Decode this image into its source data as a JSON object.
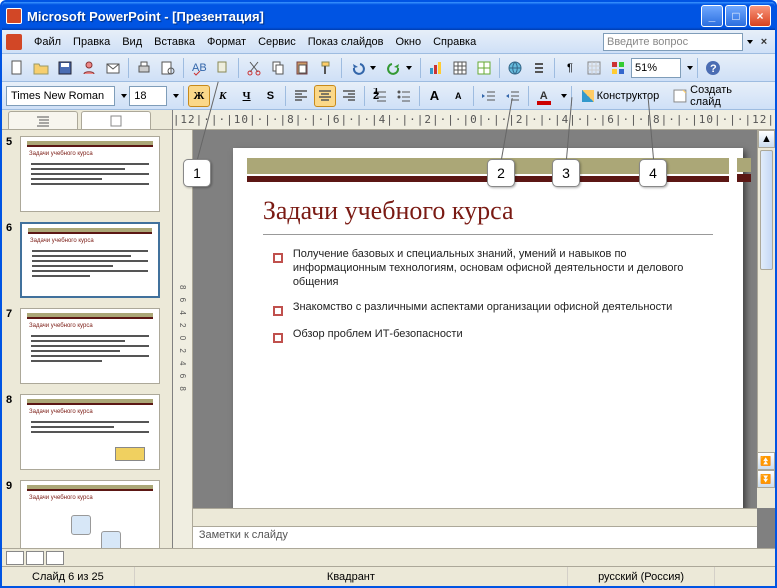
{
  "title": "Microsoft PowerPoint - [Презентация]",
  "menus": [
    "Файл",
    "Правка",
    "Вид",
    "Вставка",
    "Формат",
    "Сервис",
    "Показ слайдов",
    "Окно",
    "Справка"
  ],
  "help_placeholder": "Введите вопрос",
  "zoom": "51%",
  "font_name": "Times New Roman",
  "font_size": "18",
  "design_btn": "Конструктор",
  "new_slide_btn": "Создать слайд",
  "ruler_text": "|12|·|·|10|·|·|8|·|·|6|·|·|4|·|·|2|·|·|0|·|·|2|·|·|4|·|·|6|·|·|8|·|·|10|·|·|12|",
  "thumbs": [
    {
      "num": "5"
    },
    {
      "num": "6"
    },
    {
      "num": "7"
    },
    {
      "num": "8"
    },
    {
      "num": "9"
    }
  ],
  "slide": {
    "title": "Задачи учебного курса",
    "bullets": [
      "Получение базовых и специальных знаний, умений и навыков по информационным технологиям, основам офисной деятельности и делового общения",
      "Знакомство с различными аспектами организации офисной деятельности",
      "Обзор проблем ИТ-безопасности"
    ]
  },
  "notes_placeholder": "Заметки к слайду",
  "status": {
    "slide": "Слайд 6 из 25",
    "layout": "Квадрант",
    "lang": "русский (Россия)"
  },
  "callouts": [
    "1",
    "2",
    "3",
    "4"
  ]
}
